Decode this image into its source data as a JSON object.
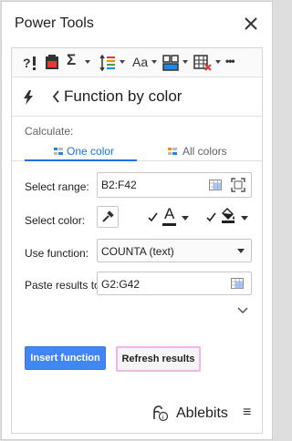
{
  "window": {
    "title": "Power Tools"
  },
  "toolbar": {
    "icons": [
      "find-replace-icon",
      "paste-icon",
      "sum-icon",
      "sort-icon",
      "text-case-icon",
      "merge-icon",
      "clear-icon",
      "more-icon"
    ],
    "case_label": "Aa",
    "sigma": "Σ",
    "more": "•••"
  },
  "header": {
    "title": "Function by color"
  },
  "calculate": {
    "label": "Calculate:",
    "tabs": [
      {
        "label": "One color",
        "active": true
      },
      {
        "label": "All colors",
        "active": false
      }
    ]
  },
  "form": {
    "range_label": "Select range:",
    "range_value": "B2:F42",
    "color_label": "Select color:",
    "font_color_letter": "A",
    "function_label": "Use function:",
    "function_value": "COUNTA (text)",
    "paste_label": "Paste results to:",
    "paste_value": "G2:G42"
  },
  "buttons": {
    "insert": "Insert function",
    "refresh": "Refresh results"
  },
  "footer": {
    "brand": "Ablebits",
    "menu_icon": "≡"
  },
  "colors": {
    "accent": "#1a73e8",
    "primary_button": "#4285f4",
    "refresh_border": "#f0b6e8",
    "font_color_bar": "#202124"
  }
}
